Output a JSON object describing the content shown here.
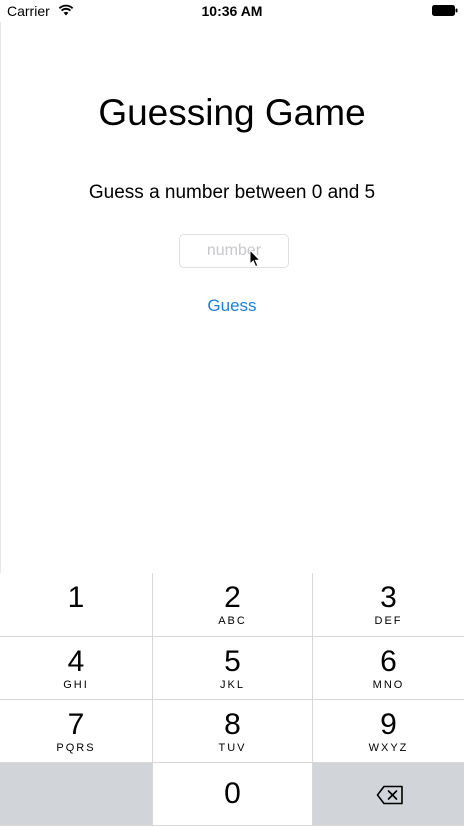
{
  "status_bar": {
    "carrier": "Carrier",
    "time": "10:36 AM"
  },
  "main": {
    "title": "Guessing Game",
    "instruction": "Guess a number between 0 and 5",
    "number_input": {
      "value": "",
      "placeholder": "number"
    },
    "guess_label": "Guess"
  },
  "keypad": {
    "keys": [
      {
        "digit": "1",
        "letters": ""
      },
      {
        "digit": "2",
        "letters": "ABC"
      },
      {
        "digit": "3",
        "letters": "DEF"
      },
      {
        "digit": "4",
        "letters": "GHI"
      },
      {
        "digit": "5",
        "letters": "JKL"
      },
      {
        "digit": "6",
        "letters": "MNO"
      },
      {
        "digit": "7",
        "letters": "PQRS"
      },
      {
        "digit": "8",
        "letters": "TUV"
      },
      {
        "digit": "9",
        "letters": "WXYZ"
      },
      {
        "digit": "0",
        "letters": ""
      }
    ],
    "delete_icon": "backspace-icon"
  },
  "colors": {
    "link": "#1a7fd6",
    "keypad_gray": "#d1d4d9",
    "placeholder": "#c7c7cd"
  }
}
